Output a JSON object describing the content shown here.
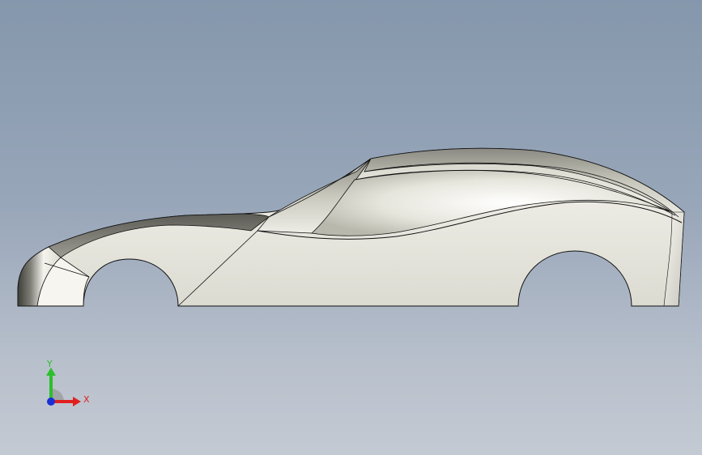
{
  "viewport": {
    "background_top": "#8597ac",
    "background_bottom": "#c4cad3",
    "model": {
      "name": "sports car body",
      "view": "side",
      "surface_color": "#e9e8df",
      "edge_color": "#111111"
    },
    "triad": {
      "x_label": "X",
      "y_label": "Y",
      "x_color": "#e02020",
      "y_color": "#2bbf2b",
      "z_color": "#1a2fd6"
    }
  }
}
